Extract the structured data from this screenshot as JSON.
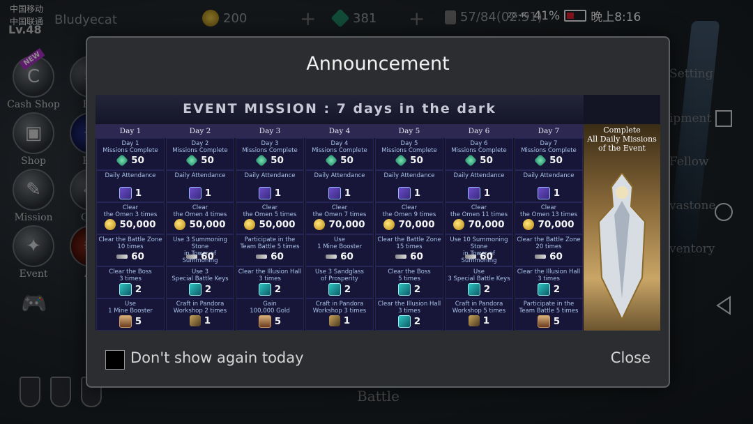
{
  "status_bar": {
    "carrier1": "中国移动",
    "carrier2": "中国联通",
    "battery": "41%",
    "time": "晚上8:16",
    "signal": "2G 4G"
  },
  "player": {
    "level": "Lv.48",
    "name": "Bludyecat"
  },
  "resources": {
    "gold": "200",
    "gems": "381",
    "stamina": "57/84(02:51)"
  },
  "left_menu": [
    {
      "label": "Cash Shop",
      "badge": "NEW"
    },
    {
      "label": "Shop"
    },
    {
      "label": "Mission"
    },
    {
      "label": "Event"
    }
  ],
  "left_menu_col2": [
    "Ble",
    "Par",
    "Coll",
    "Ac"
  ],
  "right_menu": [
    "Setting",
    "ipment",
    "Fellow",
    "vastone",
    "ventory"
  ],
  "bottom": {
    "battle_label": "Battle"
  },
  "dialog": {
    "title": "Announcement",
    "dont_show_label": "Don't show again today",
    "close_label": "Close"
  },
  "banner": {
    "title": "EVENT MISSION : 7 days in the dark",
    "complete_text": "Complete\nAll Daily Missions\nof the Event",
    "days": [
      {
        "day": "Day 1",
        "missions": [
          {
            "text": "Day 1\nMissions Complete",
            "icon": "gem",
            "reward": "50"
          },
          {
            "text": "Daily Attendance",
            "icon": "att",
            "reward": "1"
          },
          {
            "text": "Clear\nthe Omen 3 times",
            "icon": "gold",
            "reward": "50,000"
          },
          {
            "text": "Clear the Battle Zone\n10 times",
            "icon": "key",
            "reward": "60"
          },
          {
            "text": "Clear the Boss\n3 times",
            "icon": "ticket",
            "reward": "2"
          },
          {
            "text": "Use\n1 Mine Booster",
            "icon": "hourglass",
            "reward": "5"
          }
        ]
      },
      {
        "day": "Day 2",
        "missions": [
          {
            "text": "Day 2\nMissions Complete",
            "icon": "gem",
            "reward": "50"
          },
          {
            "text": "Daily Attendance",
            "icon": "att",
            "reward": "1"
          },
          {
            "text": "Clear\nthe Omen 4 times",
            "icon": "gold",
            "reward": "50,000"
          },
          {
            "text": "Use 3 Summoning Stone\nin Tower of Summoning",
            "icon": "key",
            "reward": "60"
          },
          {
            "text": "Use 3\nSpecial Battle Keys",
            "icon": "ticket",
            "reward": "2"
          },
          {
            "text": "Craft in Pandora\nWorkshop 2 times",
            "icon": "wrench",
            "reward": "1"
          }
        ]
      },
      {
        "day": "Day 3",
        "missions": [
          {
            "text": "Day 3\nMissions Complete",
            "icon": "gem",
            "reward": "50"
          },
          {
            "text": "Daily Attendance",
            "icon": "att",
            "reward": "1"
          },
          {
            "text": "Clear\nthe Omen 5 times",
            "icon": "gold",
            "reward": "50,000"
          },
          {
            "text": "Participate in the\nTeam Battle 5 times",
            "icon": "key",
            "reward": "60"
          },
          {
            "text": "Clear the Illusion Hall\n3 times",
            "icon": "ticket",
            "reward": "2"
          },
          {
            "text": "Gain\n100,000 Gold",
            "icon": "hourglass",
            "reward": "5"
          }
        ]
      },
      {
        "day": "Day 4",
        "missions": [
          {
            "text": "Day 4\nMissions Complete",
            "icon": "gem",
            "reward": "50"
          },
          {
            "text": "Daily Attendance",
            "icon": "att",
            "reward": "1"
          },
          {
            "text": "Clear\nthe Omen 7 times",
            "icon": "gold",
            "reward": "70,000"
          },
          {
            "text": "Use\n1 Mine Booster",
            "icon": "key",
            "reward": "60"
          },
          {
            "text": "Use 3 Sandglass\nof Prosperity",
            "icon": "ticket",
            "reward": "2"
          },
          {
            "text": "Craft in Pandora\nWorkshop 3 times",
            "icon": "wrench",
            "reward": "1"
          }
        ]
      },
      {
        "day": "Day 5",
        "missions": [
          {
            "text": "Day 5\nMissions Complete",
            "icon": "gem",
            "reward": "50"
          },
          {
            "text": "Daily Attendance",
            "icon": "att",
            "reward": "1"
          },
          {
            "text": "Clear\nthe Omen 9 times",
            "icon": "gold",
            "reward": "70,000"
          },
          {
            "text": "Clear the Battle Zone\n15 times",
            "icon": "key",
            "reward": "60"
          },
          {
            "text": "Clear the Boss\n5 times",
            "icon": "ticket",
            "reward": "2"
          },
          {
            "text": "Clear the Illusion Hall\n3 times",
            "icon": "ticket",
            "reward": "2"
          }
        ]
      },
      {
        "day": "Day 6",
        "missions": [
          {
            "text": "Day 6\nMissions Complete",
            "icon": "gem",
            "reward": "50"
          },
          {
            "text": "Daily Attendance",
            "icon": "att",
            "reward": "1"
          },
          {
            "text": "Clear\nthe Omen 11 times",
            "icon": "gold",
            "reward": "70,000"
          },
          {
            "text": "Use 10 Summoning Stone\nin Tower of Summoning",
            "icon": "key",
            "reward": "60"
          },
          {
            "text": "Use\n3 Special Battle Keys",
            "icon": "ticket",
            "reward": "2"
          },
          {
            "text": "Craft in Pandora\nWorkshop 5 times",
            "icon": "wrench",
            "reward": "1"
          }
        ]
      },
      {
        "day": "Day 7",
        "missions": [
          {
            "text": "Day 7\nMissions Complete",
            "icon": "gem",
            "reward": "50"
          },
          {
            "text": "Daily Attendance",
            "icon": "att",
            "reward": "1"
          },
          {
            "text": "Clear\nthe Omen 13 times",
            "icon": "gold",
            "reward": "70,000"
          },
          {
            "text": "Clear the Battle Zone\n20 times",
            "icon": "key",
            "reward": "60"
          },
          {
            "text": "Clear the Illusion Hall\n3 times",
            "icon": "ticket",
            "reward": "2"
          },
          {
            "text": "Participate in the\nTeam Battle 5 times",
            "icon": "hourglass",
            "reward": "5"
          }
        ]
      }
    ]
  }
}
